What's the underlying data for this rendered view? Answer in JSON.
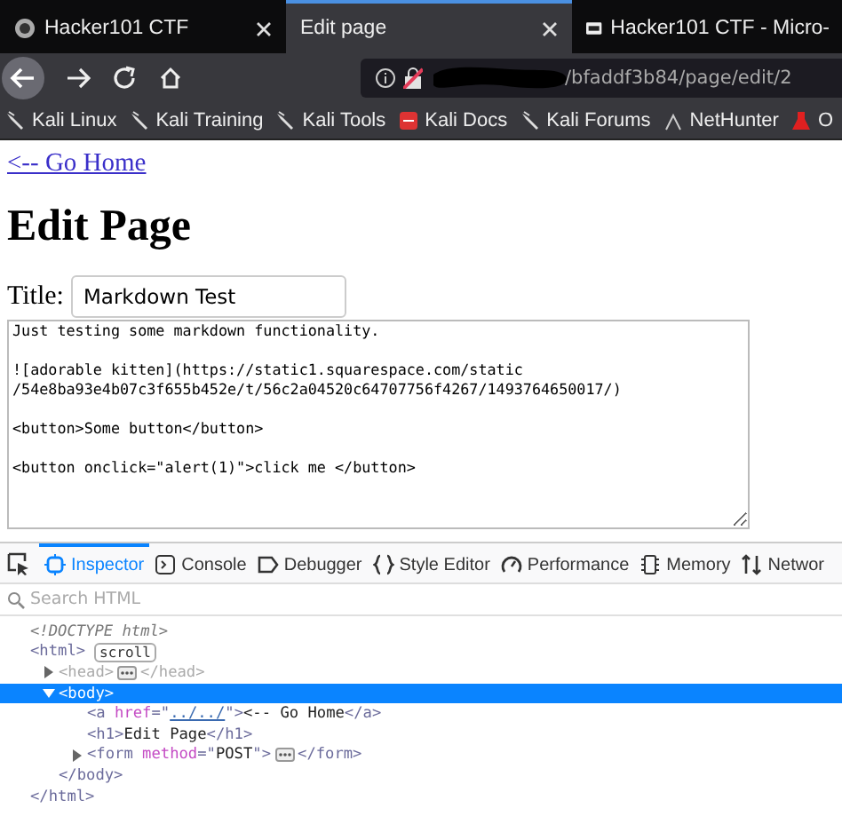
{
  "browser_tabs": [
    {
      "label": "Hacker101 CTF",
      "selected": false
    },
    {
      "label": "Edit page",
      "selected": true
    },
    {
      "label": "Hacker101 CTF - Micro-",
      "selected": false
    }
  ],
  "address_bar": {
    "url": "/bfaddf3b84/page/edit/2",
    "redacted": true
  },
  "bookmarks": [
    {
      "label": "Kali Linux"
    },
    {
      "label": "Kali Training"
    },
    {
      "label": "Kali Tools"
    },
    {
      "label": "Kali Docs"
    },
    {
      "label": "Kali Forums"
    },
    {
      "label": "NetHunter"
    },
    {
      "label": "O"
    }
  ],
  "page": {
    "home_link": "<-- Go Home",
    "heading": "Edit Page",
    "title_label": "Title:",
    "title_value": "Markdown Test",
    "body": "Just testing some markdown functionality.\n\n![adorable kitten](https://static1.squarespace.com/static\n/54e8ba93e4b07c3f655b452e/t/56c2a04520c64707756f4267/1493764650017/)\n\n<button>Some button</button>\n\n<button onclick=\"alert(1)\">click me </button>"
  },
  "devtools": {
    "tabs": [
      {
        "label": "Inspector",
        "selected": true
      },
      {
        "label": "Console",
        "selected": false
      },
      {
        "label": "Debugger",
        "selected": false
      },
      {
        "label": "Style Editor",
        "selected": false
      },
      {
        "label": "Performance",
        "selected": false
      },
      {
        "label": "Memory",
        "selected": false
      },
      {
        "label": "Networ",
        "selected": false
      }
    ],
    "search_placeholder": "Search HTML",
    "tree": [
      {
        "parts": [
          {
            "kind": "doctype",
            "text": "<!DOCTYPE html>"
          }
        ],
        "selected": false
      },
      {
        "parts": [
          {
            "kind": "tag",
            "text": "<html>"
          }
        ],
        "badge": "scroll",
        "selected": false,
        "children": [
          {
            "parts": [
              {
                "kind": "tag",
                "text": "<head>"
              },
              {
                "kind": "ellipsis"
              },
              {
                "kind": "tag",
                "text": "</head>"
              }
            ],
            "expanded": false,
            "dimmed": true,
            "selected": false
          },
          {
            "parts": [
              {
                "kind": "tag",
                "text": "<body>"
              }
            ],
            "expanded": true,
            "selected": true,
            "children": [
              {
                "parts": [
                  {
                    "kind": "tag",
                    "text": "<a "
                  },
                  {
                    "kind": "attr",
                    "text": "href"
                  },
                  {
                    "kind": "tag",
                    "text": "=\""
                  },
                  {
                    "kind": "link",
                    "text": "../../"
                  },
                  {
                    "kind": "tag",
                    "text": "\">"
                  },
                  {
                    "kind": "text",
                    "text": "<-- Go Home"
                  },
                  {
                    "kind": "tag",
                    "text": "</a>"
                  }
                ],
                "selected": false
              },
              {
                "parts": [
                  {
                    "kind": "tag",
                    "text": "<h1>"
                  },
                  {
                    "kind": "text",
                    "text": "Edit Page"
                  },
                  {
                    "kind": "tag",
                    "text": "</h1>"
                  }
                ],
                "selected": false
              },
              {
                "parts": [
                  {
                    "kind": "tag",
                    "text": "<form "
                  },
                  {
                    "kind": "attr",
                    "text": "method"
                  },
                  {
                    "kind": "tag",
                    "text": "=\""
                  },
                  {
                    "kind": "text",
                    "text": "POST"
                  },
                  {
                    "kind": "tag",
                    "text": "\">"
                  },
                  {
                    "kind": "ellipsis"
                  },
                  {
                    "kind": "tag",
                    "text": "</form>"
                  }
                ],
                "expanded": false,
                "selected": false
              }
            ]
          },
          {
            "parts": [
              {
                "kind": "tag",
                "text": "</body>"
              }
            ],
            "selected": false
          }
        ]
      },
      {
        "parts": [
          {
            "kind": "tag",
            "text": "</html>"
          }
        ],
        "selected": false
      }
    ]
  }
}
